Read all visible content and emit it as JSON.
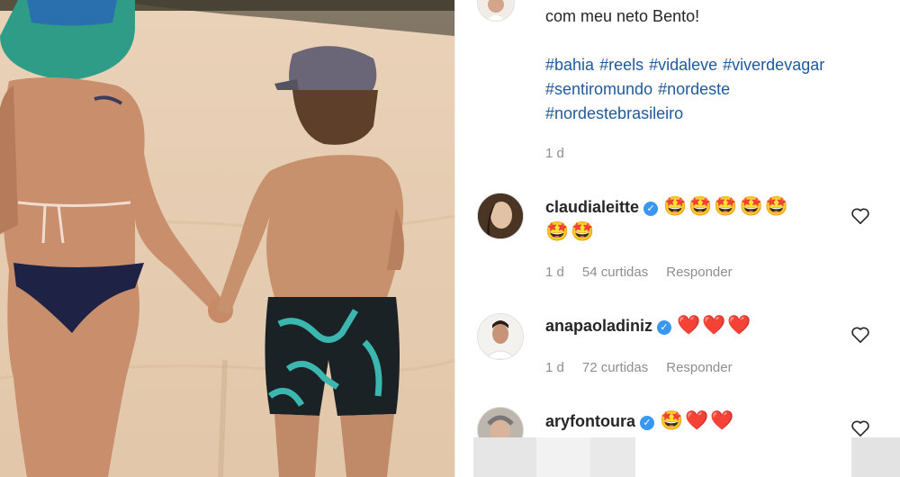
{
  "caption": {
    "line1": "com meu neto Bento!",
    "hashtags": [
      [
        "#bahia",
        "#reels",
        "#vidaleve",
        "#viverdevagar"
      ],
      [
        "#sentiromundo",
        "#nordeste"
      ],
      [
        "#nordestebrasileiro"
      ]
    ],
    "time": "1 d"
  },
  "comments": [
    {
      "username": "claudialeitte",
      "verified": true,
      "text_line1": "🤩🤩🤩🤩🤩",
      "text_line2": "🤩🤩",
      "time": "1 d",
      "likes": "54 curtidas",
      "reply": "Responder"
    },
    {
      "username": "anapaoladiniz",
      "verified": true,
      "text_line1": "❤️❤️❤️",
      "time": "1 d",
      "likes": "72 curtidas",
      "reply": "Responder"
    },
    {
      "username": "aryfontoura",
      "verified": true,
      "text_line1": "🤩❤️❤️"
    }
  ],
  "icons": {
    "verified": "verified-badge-icon",
    "like": "heart-outline-icon"
  },
  "colors": {
    "hashtag": "#1f5a9c",
    "verified": "#3897f0",
    "meta": "#8e8e8e",
    "text": "#262626"
  }
}
